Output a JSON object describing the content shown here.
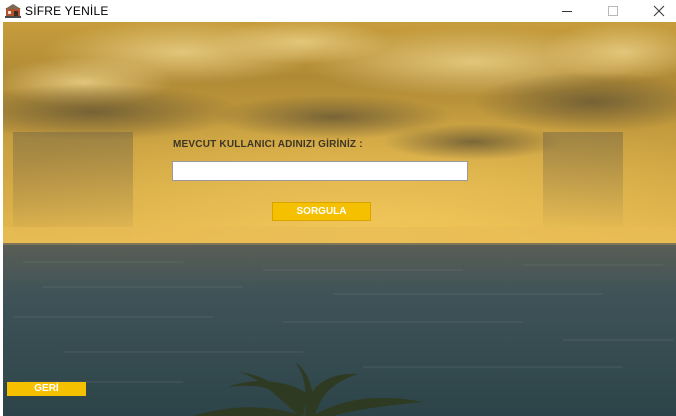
{
  "window": {
    "title": "SİFRE YENİLE",
    "controls": {
      "minimize_icon": "minimize-icon",
      "maximize_icon": "maximize-icon",
      "close_icon": "close-icon"
    }
  },
  "form": {
    "prompt_label": "MEVCUT KULLANICI ADINIZI GİRİNİZ :",
    "username_value": "",
    "query_button_label": "SORGULA"
  },
  "footer": {
    "back_button_label": "GERİ"
  },
  "colors": {
    "button_yellow": "#f5c000",
    "button_text": "#ffffff",
    "label_text": "#3d3526"
  }
}
